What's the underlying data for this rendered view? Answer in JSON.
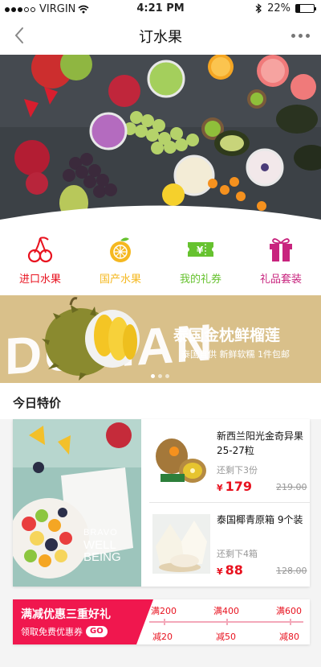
{
  "status_bar": {
    "carrier": "VIRGIN",
    "time": "4:21 PM",
    "battery": "22%",
    "battery_level": 0.22
  },
  "nav": {
    "title": "订水果",
    "back_icon": "chevron-left-icon",
    "more_icon": "more-dots-icon"
  },
  "categories": [
    {
      "label": "进口水果",
      "icon": "cherry-icon",
      "color": "#e8121f"
    },
    {
      "label": "国产水果",
      "icon": "orange-icon",
      "color": "#f5b820"
    },
    {
      "label": "我的礼券",
      "icon": "coupon-icon",
      "color": "#66c22f"
    },
    {
      "label": "礼品套装",
      "icon": "gift-icon",
      "color": "#c8247e"
    }
  ],
  "banner": {
    "big_text": "DURIAN",
    "headline": "泰国金枕鲜榴莲",
    "subline": "泰国直供 新鲜软糯 1件包邮",
    "slide_count": 3,
    "active_slide": 1
  },
  "today_deals": {
    "title": "今日特价",
    "poster_text_1": "BRAVO",
    "poster_text_2": "WELL",
    "poster_text_3": "BEING",
    "items": [
      {
        "name": "新西兰阳光金奇异果 25-27粒",
        "stock": "还剩下3份",
        "currency": "¥",
        "price": "179",
        "original_price": "219.00"
      },
      {
        "name": "泰国椰青原箱 9个装",
        "stock": "还剩下4箱",
        "currency": "¥",
        "price": "88",
        "original_price": "128.00"
      }
    ]
  },
  "promo": {
    "title": "满减优惠三重好礼",
    "subtitle": "领取免费优惠券",
    "go_label": "GO",
    "tiers": [
      {
        "threshold": "满200",
        "discount": "减20"
      },
      {
        "threshold": "满400",
        "discount": "减50"
      },
      {
        "threshold": "满600",
        "discount": "减80"
      }
    ]
  },
  "colors": {
    "accent_red": "#e8121f",
    "promo_pink": "#f0174e",
    "banner_gold": "#d9c08a"
  }
}
